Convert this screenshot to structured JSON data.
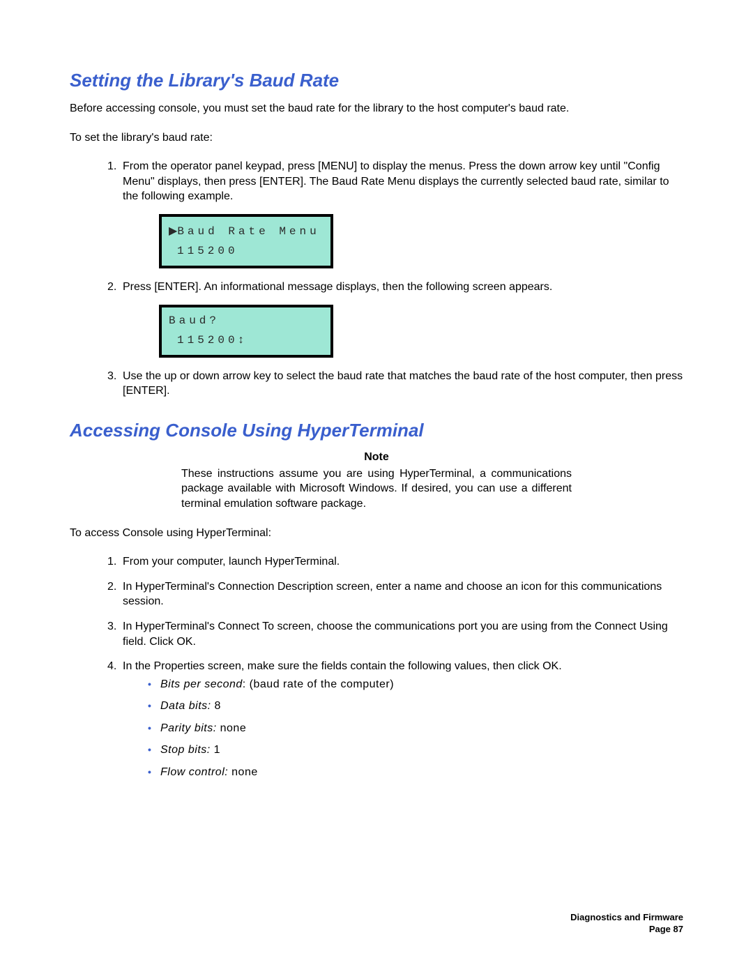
{
  "section1": {
    "title": "Setting the Library's Baud Rate",
    "intro": "Before accessing console, you must set the baud rate for the library to the host computer's baud rate.",
    "lead": "To set the library's baud rate:",
    "steps": [
      "From the operator panel keypad, press [MENU] to display the menus. Press the down arrow key until \"Config Menu\" displays, then press [ENTER]. The Baud Rate Menu displays the currently selected baud rate, similar to the following example.",
      "Press [ENTER]. An informational message displays, then the following screen appears.",
      "Use the up or down arrow key to select the baud rate that matches the baud rate of the host computer, then press [ENTER]."
    ],
    "lcd1": {
      "line1_prefix": "▶",
      "line1": "Baud Rate Menu",
      "line2": "115200"
    },
    "lcd2": {
      "line1": "Baud?",
      "line2": "115200",
      "line2_suffix": "↕"
    }
  },
  "section2": {
    "title": "Accessing Console Using HyperTerminal",
    "note_label": "Note",
    "note_body": "These instructions assume you are using HyperTerminal, a communications package available with Microsoft Windows. If desired, you can use a different terminal emulation software package.",
    "lead": "To access Console using HyperTerminal:",
    "steps": [
      "From your computer, launch HyperTerminal.",
      "In HyperTerminal's Connection Description screen, enter a name and choose an icon for this communications session.",
      "In HyperTerminal's Connect To screen, choose the communications port you are using from the Connect Using field. Click OK.",
      "In the Properties screen, make sure the fields contain the following values, then click OK."
    ],
    "props": [
      {
        "label": "Bits per second",
        "value": ": (baud rate of the computer)"
      },
      {
        "label": "Data bits:",
        "value": " 8"
      },
      {
        "label": "Parity bits:",
        "value": " none"
      },
      {
        "label": "Stop bits:",
        "value": " 1"
      },
      {
        "label": "Flow control:",
        "value": " none"
      }
    ]
  },
  "footer": {
    "chapter": "Diagnostics and Firmware",
    "page": "Page 87"
  }
}
